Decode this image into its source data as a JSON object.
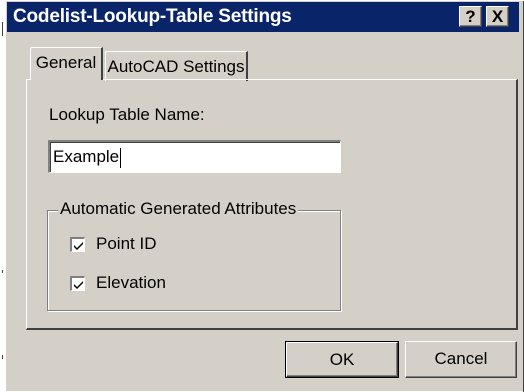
{
  "window": {
    "title": "Codelist-Lookup-Table Settings",
    "help_label": "?",
    "close_label": "X"
  },
  "tabs": [
    {
      "label": "General",
      "selected": true
    },
    {
      "label": "AutoCAD Settings",
      "selected": false
    }
  ],
  "general": {
    "name_label": "Lookup Table Name:",
    "name_value": "Example",
    "group_title": "Automatic Generated Attributes",
    "checkboxes": [
      {
        "label": "Point ID",
        "checked": true
      },
      {
        "label": "Elevation",
        "checked": true
      }
    ]
  },
  "buttons": {
    "ok_label": "OK",
    "cancel_label": "Cancel"
  },
  "colors": {
    "titlebar": "#0a246a",
    "face": "#d4d0c8"
  }
}
